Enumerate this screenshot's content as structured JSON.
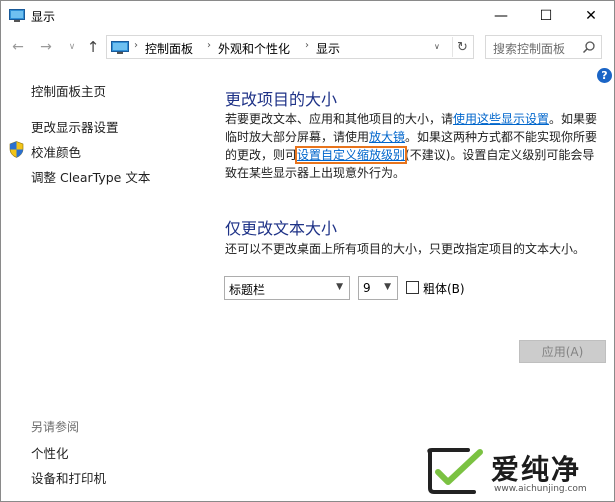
{
  "window": {
    "title": "显示",
    "minimize": "—",
    "maximize": "☐",
    "close": "✕"
  },
  "nav": {
    "back": "←",
    "forward": "→",
    "dropdown": "∨",
    "up": "↑",
    "breadcrumb": [
      "控制面板",
      "外观和个性化",
      "显示"
    ],
    "separator": "›",
    "refresh": "↻"
  },
  "search": {
    "placeholder": "搜索控制面板"
  },
  "sidebar": {
    "items": [
      {
        "label": "控制面板主页"
      },
      {
        "label": "更改显示器设置"
      },
      {
        "label": "校准颜色"
      },
      {
        "label": "调整 ClearType 文本"
      }
    ],
    "see_also_title": "另请参阅",
    "see_also": [
      {
        "label": "个性化"
      },
      {
        "label": "设备和打印机"
      }
    ]
  },
  "main": {
    "help": "?",
    "section1": {
      "heading": "更改项目的大小",
      "line1_pre": "若要更改文本、应用和其他项目的大小，请",
      "line1_link": "使用这些显示设置",
      "line1_post": "。如果要",
      "line2_pre": "临时放大部分屏幕，请使用",
      "line2_link": "放大镜",
      "line2_post": "。如果这两种方式都不能实现你所要",
      "line3_pre": "的更改，则可",
      "line3_link": "设置自定义缩放级别",
      "line3_post": "(不建议)。设置自定义级别可能会导",
      "line4": "致在某些显示器上出现意外行为。"
    },
    "section2": {
      "heading": "仅更改文本大小",
      "desc": "还可以不更改桌面上所有项目的大小，只更改指定项目的文本大小。",
      "item_select": "标题栏",
      "size_select": "9",
      "bold_label": "粗体(B)",
      "bold_checked": false
    },
    "apply": "应用(A)"
  },
  "watermark": {
    "text": "爱纯净",
    "url": "www.aichunjing.com"
  }
}
